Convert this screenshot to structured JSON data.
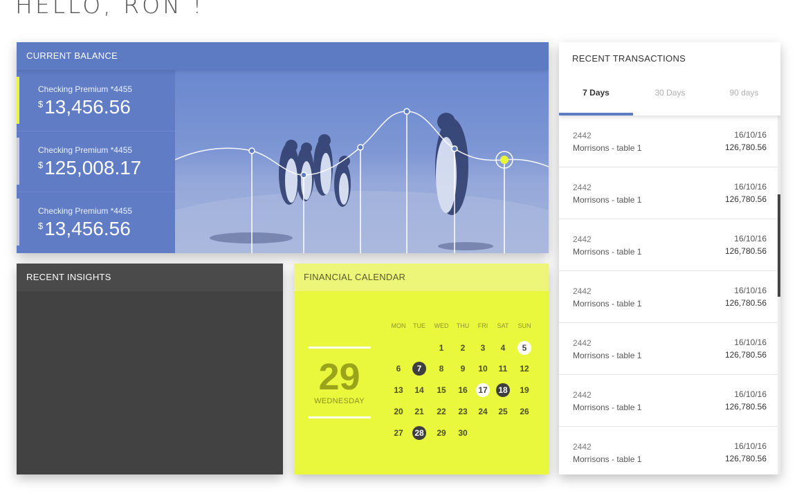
{
  "greeting": "HELLO, RON !",
  "balance": {
    "title": "CURRENT BALANCE",
    "accounts": [
      {
        "label": "Checking Premium *4455",
        "currency": "$",
        "amount": "13,456.56"
      },
      {
        "label": "Checking Premium *4455",
        "currency": "$",
        "amount": "125,008.17"
      },
      {
        "label": "Checking Premium *4455",
        "currency": "$",
        "amount": "13,456.56"
      }
    ]
  },
  "insights": {
    "title": "RECENT INSIGHTS"
  },
  "calendar": {
    "title": "FINANCIAL CALENDAR",
    "big_day": "29",
    "big_weekday": "WEDNESDAY",
    "weekdays": [
      "MON",
      "TUE",
      "WED",
      "THU",
      "FRI",
      "SAT",
      "SUN"
    ],
    "weeks": [
      [
        "",
        "",
        "1",
        "2",
        "3",
        "4",
        "5"
      ],
      [
        "6",
        "7",
        "8",
        "9",
        "10",
        "11",
        "12"
      ],
      [
        "13",
        "14",
        "15",
        "16",
        "17",
        "18",
        "19"
      ],
      [
        "20",
        "21",
        "22",
        "23",
        "24",
        "25",
        "26"
      ],
      [
        "27",
        "28",
        "29",
        "30",
        "",
        "",
        ""
      ]
    ],
    "highlight_dark": [
      "7",
      "18",
      "28"
    ],
    "highlight_light": [
      "5",
      "17"
    ]
  },
  "transactions": {
    "title": "RECENT TRANSACTIONS",
    "tabs": [
      "7 Days",
      "30 Days",
      "90 days"
    ],
    "active_tab": "7 Days",
    "items": [
      {
        "ref": "2442",
        "name": "Morrisons - table 1",
        "date": "16/10/16",
        "amount": "126,780.56"
      },
      {
        "ref": "2442",
        "name": "Morrisons - table 1",
        "date": "16/10/16",
        "amount": "126,780.56"
      },
      {
        "ref": "2442",
        "name": "Morrisons - table 1",
        "date": "16/10/16",
        "amount": "126,780.56"
      },
      {
        "ref": "2442",
        "name": "Morrisons - table 1",
        "date": "16/10/16",
        "amount": "126,780.56"
      },
      {
        "ref": "2442",
        "name": "Morrisons - table 1",
        "date": "16/10/16",
        "amount": "126,780.56"
      },
      {
        "ref": "2442",
        "name": "Morrisons - table 1",
        "date": "16/10/16",
        "amount": "126,780.56"
      },
      {
        "ref": "2442",
        "name": "Morrisons - table 1",
        "date": "16/10/16",
        "amount": "126,780.56"
      }
    ]
  },
  "colors": {
    "accent_blue": "#5d7bc3",
    "accent_yellow": "#e8f53a",
    "dark_panel": "#424242"
  }
}
